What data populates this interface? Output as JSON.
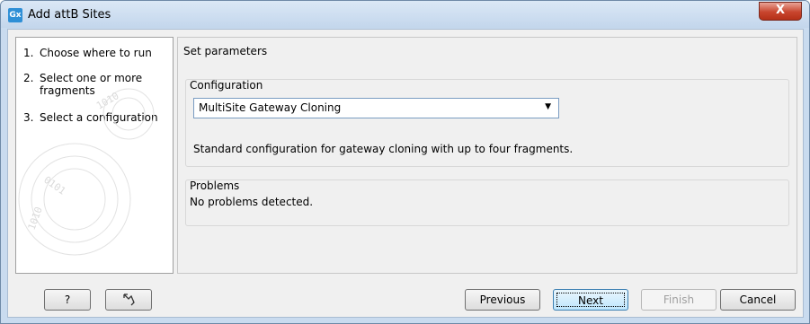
{
  "window": {
    "icon_text": "Gx",
    "title": "Add attB Sites",
    "close_glyph": "X"
  },
  "steps": [
    {
      "num": "1.",
      "label": "Choose where to run"
    },
    {
      "num": "2.",
      "label": "Select one or more fragments"
    },
    {
      "num": "3.",
      "label": "Select a configuration"
    }
  ],
  "main": {
    "heading": "Set parameters",
    "configuration": {
      "group_label": "Configuration",
      "selected": "MultiSite Gateway Cloning",
      "description": "Standard configuration for gateway cloning with up to four fragments."
    },
    "problems": {
      "group_label": "Problems",
      "message": "No problems detected."
    }
  },
  "buttons": {
    "help": "?",
    "reset_icon": "reset-arrow-icon",
    "previous": "Previous",
    "next": "Next",
    "finish": "Finish",
    "cancel": "Cancel"
  }
}
